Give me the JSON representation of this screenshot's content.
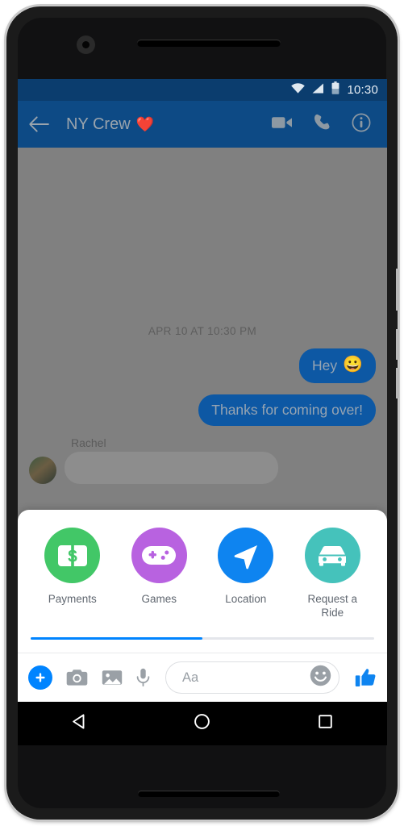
{
  "device": {
    "name": "android-phone",
    "camera": "front-camera-icon",
    "earpiece": "earpiece-speaker",
    "speaker": "bottom-speaker"
  },
  "status_bar": {
    "time": "10:30",
    "icons": [
      "wifi-icon",
      "cellular-signal-icon",
      "battery-icon"
    ],
    "background": "#0b3d6e"
  },
  "app_bar": {
    "back_label": "back-arrow",
    "title": "NY Crew",
    "title_emoji": "❤️",
    "actions": [
      {
        "name": "video-call-button",
        "label": "Video call"
      },
      {
        "name": "voice-call-button",
        "label": "Voice call"
      },
      {
        "name": "thread-info-button",
        "label": "Info"
      }
    ],
    "background": "#0d4a85"
  },
  "conversation": {
    "date_divider": "APR 10 AT 10:30 PM",
    "messages": [
      {
        "direction": "outgoing",
        "text": "Hey",
        "emoji": "😀"
      },
      {
        "direction": "outgoing",
        "text": "Thanks for coming over!",
        "emoji": ""
      }
    ],
    "incoming_sender": "Rachel",
    "bubble_color": "#0d58a4",
    "dim_overlay": "#808080"
  },
  "bottom_sheet": {
    "shortcuts": [
      {
        "label": "Payments",
        "icon": "money-bill-dollar-icon",
        "color": "#42c767"
      },
      {
        "label": "Games",
        "icon": "game-controller-icon",
        "color": "#b862e0"
      },
      {
        "label": "Location",
        "icon": "paper-plane-location-icon",
        "color": "#0e84f0"
      },
      {
        "label": "Request a Ride",
        "icon": "car-icon",
        "color": "#45c2bb"
      }
    ],
    "page_indicator": {
      "pages": 2,
      "current_page": 1,
      "fill_percent": 50,
      "fill_color": "#0084ff",
      "track_color": "#e4e6eb"
    }
  },
  "composer": {
    "plus_button": "add-attachment-icon",
    "camera_button": "camera-icon",
    "gallery_button": "gallery-icon",
    "mic_button": "microphone-icon",
    "input_value": "",
    "input_placeholder": "Aa",
    "emoji_button": "smiley-face-icon",
    "like_button": "thumbs-up-icon",
    "accent_color": "#0084ff"
  },
  "nav_bar": {
    "back": "nav-back-triangle-icon",
    "home": "nav-home-circle-icon",
    "recents": "nav-recents-square-icon"
  }
}
